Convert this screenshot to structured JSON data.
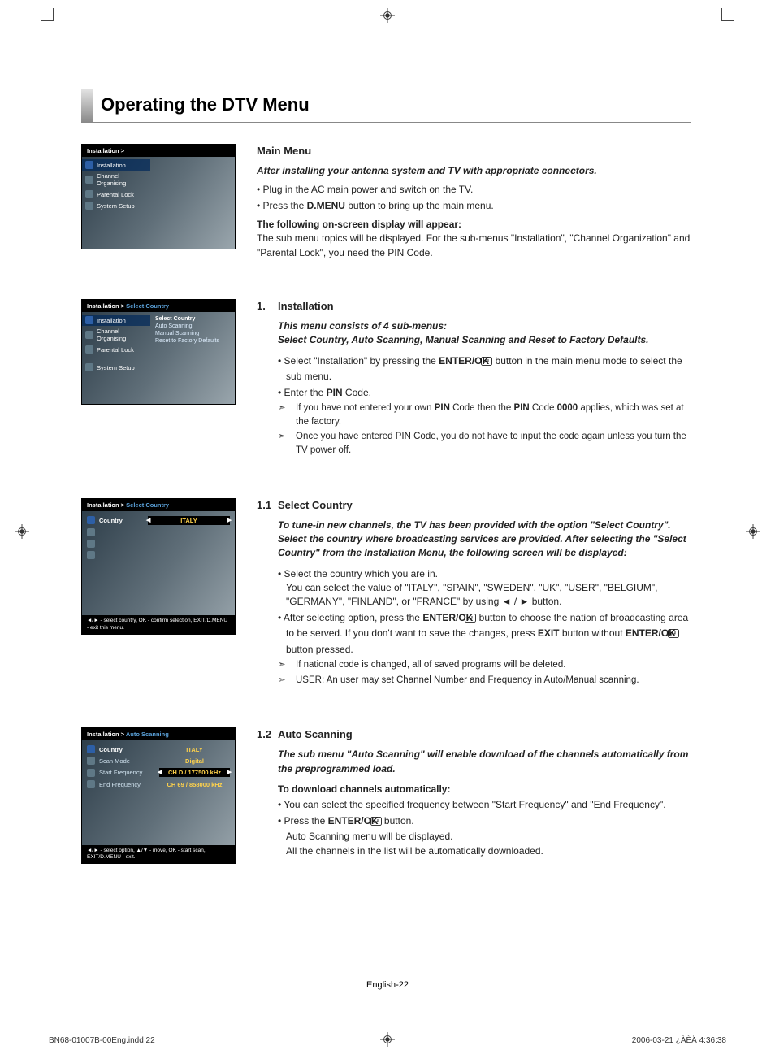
{
  "page_title": "Operating the DTV Menu",
  "page_number": "English-22",
  "imprint_left": "BN68-01007B-00Eng.indd   22",
  "imprint_right": "2006-03-21   ¿ÀÈÄ 4:36:38",
  "main_menu": {
    "heading": "Main Menu",
    "intro": "After installing your antenna system and TV with appropriate connectors.",
    "bullets": [
      "Plug in the AC main power and switch on the TV.",
      "Press the D.MENU button to bring up the main menu."
    ],
    "bullet2_pre": "Press the ",
    "bullet2_bold": "D.MENU",
    "bullet2_post": " button to bring up the main menu.",
    "following_bold": "The following on-screen display will appear:",
    "following_text": "The sub menu topics will be displayed. For the sub-menus \"Installation\", \"Channel Organization\" and \"Parental Lock\", you need the PIN Code."
  },
  "tv1": {
    "crumb": "Installation >",
    "items": [
      "Installation",
      "Channel Organising",
      "Parental Lock",
      "System Setup"
    ]
  },
  "installation": {
    "num": "1.",
    "heading": "Installation",
    "intro1": "This menu consists of 4 sub-menus:",
    "intro2": "Select Country, Auto Scanning, Manual Scanning and Reset to Factory Defaults.",
    "b1_pre": "Select \"Installation\" by pressing the ",
    "b1_bold": "ENTER/OK",
    "b1_post": " button in the main menu mode to select the sub menu.",
    "b2_pre": "Enter the ",
    "b2_bold": "PIN",
    "b2_post": " Code.",
    "note1_pre": "If you have not entered your own ",
    "note1_b1": "PIN",
    "note1_mid": " Code then the ",
    "note1_b2": "PIN",
    "note1_mid2": " Code ",
    "note1_b3": "0000",
    "note1_post": " applies, which was set at the factory.",
    "note2": "Once you have entered PIN Code, you do not have to input the code again unless you turn the TV power off."
  },
  "tv2": {
    "crumb_pre": "Installation > ",
    "crumb_sel": "Select Country",
    "items": [
      "Installation",
      "Channel Organising",
      "Parental Lock",
      "System Setup"
    ],
    "sub": [
      "Select Country",
      "Auto Scanning",
      "Manual Scanning",
      "Reset to Factory Defaults"
    ]
  },
  "select_country": {
    "num": "1.1",
    "heading": "Select Country",
    "intro1": "To tune-in new channels, the TV has been provided with the option \"Select Country\". Select the country where broadcasting services are provided. After selecting the \"Select Country\" from the Installation Menu, the following screen will be displayed:",
    "b1": "Select the country which you are in.",
    "b1_cont": "You can select the value of \"ITALY\", \"SPAIN\", \"SWEDEN\", \"UK\", \"USER\", \"BELGIUM\", \"GERMANY\", \"FINLAND\", or \"FRANCE\" by using ◄ / ► button.",
    "b2_pre": "After selecting option, press the ",
    "b2_bold": "ENTER/OK",
    "b2_mid": " button to choose the nation of broadcasting area to be served. If you don't want to save the changes, press ",
    "b2_bold2": "EXIT",
    "b2_mid2": " button without ",
    "b2_bold3": "ENTER/OK",
    "b2_post": " button pressed.",
    "note1": "If national code is changed, all of saved programs will be deleted.",
    "note2": "USER: An user may set Channel Number and Frequency in Auto/Manual scanning."
  },
  "tv3": {
    "crumb_pre": "Installation > ",
    "crumb_sel": "Select Country",
    "field_label": "Country",
    "field_value": "ITALY",
    "footer": "◄/► - select country, OK - confirm selection, EXIT/D.MENU - exit this menu."
  },
  "auto_scan": {
    "num": "1.2",
    "heading": "Auto Scanning",
    "intro": "The sub menu \"Auto Scanning\" will enable download of the channels automatically from the preprogrammed load.",
    "sub_bold": "To download channels automatically:",
    "b1": "You can select the specified frequency between \"Start Frequency\" and \"End Frequency\".",
    "b2_pre": "Press the ",
    "b2_bold": "ENTER/OK",
    "b2_post": " button.",
    "b2_cont1": "Auto Scanning menu will be displayed.",
    "b2_cont2": "All the channels in the list will be automatically downloaded."
  },
  "tv4": {
    "crumb_pre": "Installation > ",
    "crumb_sel": "Auto Scanning",
    "rows": [
      {
        "label": "Country",
        "value": "ITALY"
      },
      {
        "label": "Scan Mode",
        "value": "Digital"
      },
      {
        "label": "Start Frequency",
        "value": "CH   D / 177500 kHz",
        "box": true,
        "arrows": true
      },
      {
        "label": "End Frequency",
        "value": "CH  69 / 858000 kHz"
      }
    ],
    "footer": "◄/► - select option, ▲/▼ - move, OK - start scan, EXIT/D.MENU - exit."
  }
}
